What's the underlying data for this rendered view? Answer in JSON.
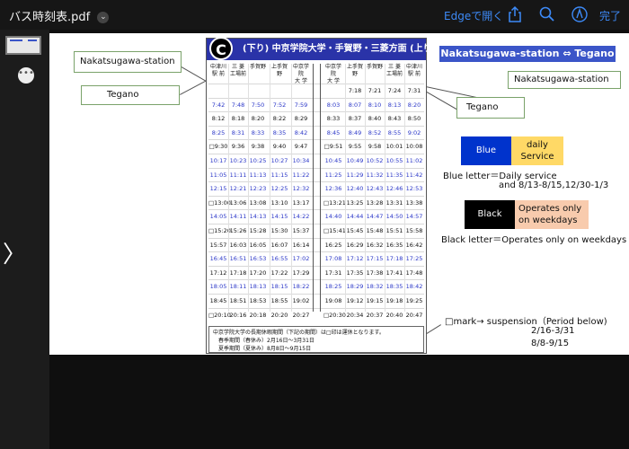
{
  "window": {
    "file_name": "バス時刻表.pdf",
    "open_in_edge": "Edgeで開く",
    "done": "完了",
    "icons": [
      "chevron-down-icon",
      "share-icon",
      "search-icon",
      "markup-icon",
      "more-icon",
      "next-page-icon"
    ]
  },
  "timetable": {
    "badge": "C",
    "title": "(下り) 中京学院大学・手賀野・三菱方面 (上り)",
    "left_headers": [
      "中津川\n駅 前",
      "三 菱\n工場前",
      "手賀野",
      "上手賀野",
      "中京学院\n大 学"
    ],
    "right_headers": [
      "中京学院\n大 学",
      "上手賀野",
      "手賀野",
      "三 菱\n工場前",
      "中津川\n駅 前"
    ],
    "rows": [
      {
        "l": [
          "",
          "",
          "",
          "",
          ""
        ],
        "r": [
          "",
          "7:18",
          "7:21",
          "7:24",
          "7:31"
        ],
        "color": "black"
      },
      {
        "l": [
          "7:42",
          "7:48",
          "7:50",
          "7:52",
          "7:59"
        ],
        "r": [
          "8:03",
          "8:07",
          "8:10",
          "8:13",
          "8:20"
        ],
        "color": "blue"
      },
      {
        "l": [
          "8:12",
          "8:18",
          "8:20",
          "8:22",
          "8:29"
        ],
        "r": [
          "8:33",
          "8:37",
          "8:40",
          "8:43",
          "8:50"
        ],
        "color": "black"
      },
      {
        "l": [
          "8:25",
          "8:31",
          "8:33",
          "8:35",
          "8:42"
        ],
        "r": [
          "8:45",
          "8:49",
          "8:52",
          "8:55",
          "9:02"
        ],
        "color": "blue"
      },
      {
        "l": [
          "□9:30",
          "9:36",
          "9:38",
          "9:40",
          "9:47"
        ],
        "r": [
          "□9:51",
          "9:55",
          "9:58",
          "10:01",
          "10:08"
        ],
        "color": "black"
      },
      {
        "l": [
          "10:17",
          "10:23",
          "10:25",
          "10:27",
          "10:34"
        ],
        "r": [
          "10:45",
          "10:49",
          "10:52",
          "10:55",
          "11:02"
        ],
        "color": "blue"
      },
      {
        "l": [
          "11:05",
          "11:11",
          "11:13",
          "11:15",
          "11:22"
        ],
        "r": [
          "11:25",
          "11:29",
          "11:32",
          "11:35",
          "11:42"
        ],
        "color": "blue"
      },
      {
        "l": [
          "12:15",
          "12:21",
          "12:23",
          "12:25",
          "12:32"
        ],
        "r": [
          "12:36",
          "12:40",
          "12:43",
          "12:46",
          "12:53"
        ],
        "color": "blue"
      },
      {
        "l": [
          "□13:00",
          "13:06",
          "13:08",
          "13:10",
          "13:17"
        ],
        "r": [
          "□13:21",
          "13:25",
          "13:28",
          "13:31",
          "13:38"
        ],
        "color": "black"
      },
      {
        "l": [
          "14:05",
          "14:11",
          "14:13",
          "14:15",
          "14:22"
        ],
        "r": [
          "14:40",
          "14:44",
          "14:47",
          "14:50",
          "14:57"
        ],
        "color": "blue"
      },
      {
        "l": [
          "□15:20",
          "15:26",
          "15:28",
          "15:30",
          "15:37"
        ],
        "r": [
          "□15:41",
          "15:45",
          "15:48",
          "15:51",
          "15:58"
        ],
        "color": "black"
      },
      {
        "l": [
          "15:57",
          "16:03",
          "16:05",
          "16:07",
          "16:14"
        ],
        "r": [
          "16:25",
          "16:29",
          "16:32",
          "16:35",
          "16:42"
        ],
        "color": "black"
      },
      {
        "l": [
          "16:45",
          "16:51",
          "16:53",
          "16:55",
          "17:02"
        ],
        "r": [
          "17:08",
          "17:12",
          "17:15",
          "17:18",
          "17:25"
        ],
        "color": "blue"
      },
      {
        "l": [
          "17:12",
          "17:18",
          "17:20",
          "17:22",
          "17:29"
        ],
        "r": [
          "17:31",
          "17:35",
          "17:38",
          "17:41",
          "17:48"
        ],
        "color": "black"
      },
      {
        "l": [
          "18:05",
          "18:11",
          "18:13",
          "18:15",
          "18:22"
        ],
        "r": [
          "18:25",
          "18:29",
          "18:32",
          "18:35",
          "18:42"
        ],
        "color": "blue"
      },
      {
        "l": [
          "18:45",
          "18:51",
          "18:53",
          "18:55",
          "19:02"
        ],
        "r": [
          "19:08",
          "19:12",
          "19:15",
          "19:18",
          "19:25"
        ],
        "color": "black"
      },
      {
        "l": [
          "□20:10",
          "20:16",
          "20:18",
          "20:20",
          "20:27"
        ],
        "r": [
          "□20:30",
          "20:34",
          "20:37",
          "20:40",
          "20:47"
        ],
        "color": "black"
      }
    ],
    "note_line1": "中京学院大学の長期休暇期間（下記の期間）は□印は運休となります。",
    "note_line2": "春季期間（春休み）2月16日～3月31日",
    "note_line3": "夏季期間（夏休み）8月8日～9月15日"
  },
  "annotations": {
    "callout_nakatsugawa_left": "Nakatsugawa-station",
    "callout_tegano_left": "Tegano",
    "callout_nakatsugawa_right": "Nakatsugawa-station",
    "callout_tegano_right": "Tegano",
    "route_banner": "Nakatsugawa-station  ⇔  Tegano",
    "blue_box": "Blue",
    "daily_box": "daily\nService",
    "blue_desc_1": "Blue letter＝Daily service",
    "blue_desc_2": "and 8/13-8/15,12/30-1/3",
    "black_box": "Black",
    "weekday_box": "Operates only\non weekdays",
    "black_desc": "Black letter＝Operates only on weekdays",
    "mark_line1": "□mark→  suspension（Period   below)",
    "mark_line2": "2/16-3/31",
    "mark_line3": "8/8-9/15"
  },
  "colors": {
    "accent_blue": "#3d8af7",
    "table_blue": "#2a33a8",
    "legend_blue": "#0033cc",
    "legend_yellow": "#ffd966",
    "legend_peach": "#f8cbad"
  }
}
